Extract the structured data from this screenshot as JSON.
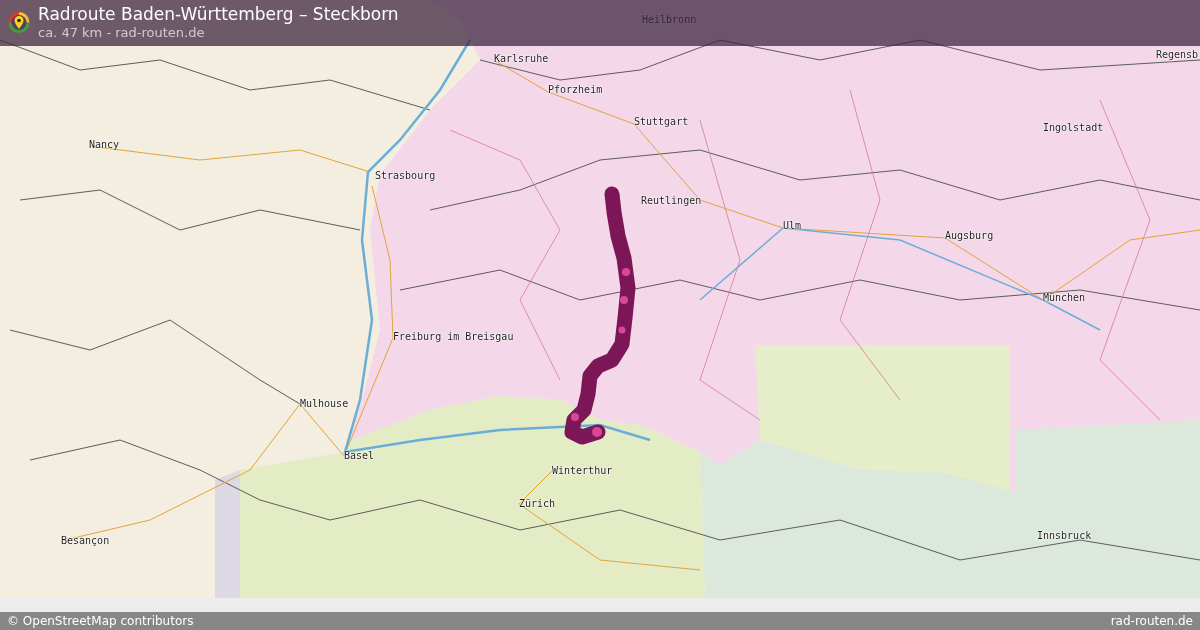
{
  "header": {
    "title": "Radroute Baden-Württemberg – Steckborn",
    "subtitle": "ca. 47 km - rad-routen.de"
  },
  "map": {
    "labels": [
      {
        "text": "Heilbronn"
      },
      {
        "text": "Regensb"
      },
      {
        "text": "Karlsruhe"
      },
      {
        "text": "Pforzheim"
      },
      {
        "text": "Stuttgart"
      },
      {
        "text": "Ingolstadt"
      },
      {
        "text": "Nancy"
      },
      {
        "text": "Strasbourg"
      },
      {
        "text": "Reutlingen"
      },
      {
        "text": "Ulm"
      },
      {
        "text": "Augsburg"
      },
      {
        "text": "München"
      },
      {
        "text": "Freiburg im Breisgau"
      },
      {
        "text": "Mulhouse"
      },
      {
        "text": "Basel"
      },
      {
        "text": "Winterthur"
      },
      {
        "text": "Zürich"
      },
      {
        "text": "Innsbruck"
      },
      {
        "text": "Besançon"
      }
    ]
  },
  "footer": {
    "attribution": "© OpenStreetMap contributors",
    "site": "rad-routen.de"
  }
}
